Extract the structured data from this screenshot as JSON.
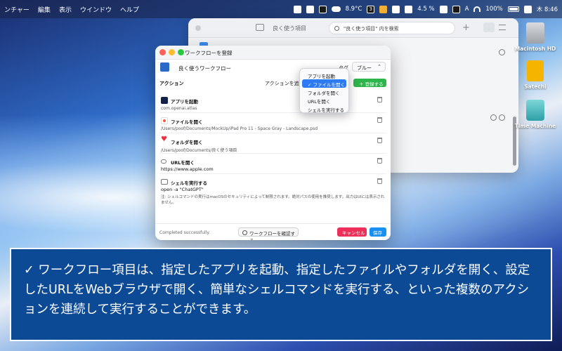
{
  "menubar": {
    "items": [
      "ンチャー",
      "編集",
      "表示",
      "ウインドウ",
      "ヘルプ"
    ],
    "temp": "8.9°C",
    "badge": "3",
    "storage": "4.5 %",
    "input": "A",
    "battery": "100%",
    "clock": "木 8:46"
  },
  "bgwindow": {
    "title": "良く使う項目",
    "search_placeholder": "\"良く使う項目\" 内を検索"
  },
  "desktop": {
    "icons": [
      "Macintosh HD",
      "Satechi",
      "Time Machine"
    ]
  },
  "dialog": {
    "title": "ワークフローを登録",
    "name": "良く使うワークフロー",
    "tag_label": "タグ",
    "tag_value": "ブルー",
    "actions_label": "アクション",
    "add_label": "アクションを追加",
    "register_label": "＋ 登録する",
    "actions": [
      {
        "name": "アプリを起動",
        "value": "com.openai.atlas",
        "color": "#13204a"
      },
      {
        "name": "ファイルを開く",
        "value": "/Users/poof/Documents/MockUp/iPad Pro 11 - Space Gray - Landscape.psd",
        "color": "#f25c3c"
      },
      {
        "name": "フォルダを開く",
        "value": "/Users/poof/Documents/良く使う項目",
        "color": "#e8333f"
      },
      {
        "name": "URLを開く",
        "value": "https://www.apple.com",
        "color": "#777777"
      },
      {
        "name": "シェルを実行する",
        "value": "open -a \"ChatGPT\"",
        "color": "#777777",
        "note": "注: シェルコマンドの実行はmacOSのセキュリティによって制限されます。絶対パスの使用を推奨します。出力はUIには表示されません。"
      }
    ],
    "status": "Completed successfully.",
    "check_label": "ワークフローを確認する",
    "cancel_label": "キャンセル",
    "save_label": "保存"
  },
  "dropdown": {
    "items": [
      "アプリを起動",
      "✓ ファイルを開く",
      "フォルダを開く",
      "URLを開く",
      "シェルを実行する"
    ],
    "selected_index": 1
  },
  "caption": {
    "text": "✓ ワークフロー項目は、指定したアプリを起動、指定したファイルやフォルダを開く、設定したURLをWebブラウザで開く、簡単なシェルコマンドを実行する、といった複数のアクションを連続して実行することができます。"
  }
}
